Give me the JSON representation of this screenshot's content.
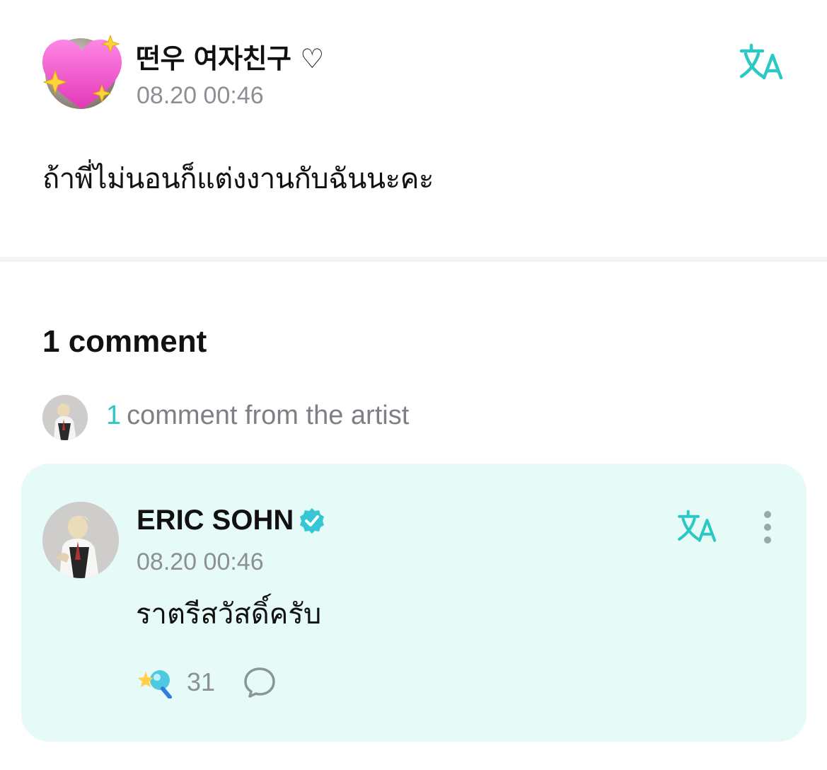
{
  "post": {
    "author": "떤우 여자친구 ♡",
    "timestamp": "08.20 00:46",
    "body": "ถ้าพี่ไม่นอนก็แต่งงานกับฉันนะคะ",
    "avatar_icon": "sparkling-heart-icon",
    "translate_icon": "translate-icon"
  },
  "comments": {
    "heading": "1 comment",
    "artist_summary": {
      "count": "1",
      "text": "comment from the artist"
    },
    "items": [
      {
        "author": "ERIC SOHN",
        "verified": true,
        "timestamp": "08.20 00:46",
        "text": "ราตรีสวัสดิ์ครับ",
        "reaction_count": "31",
        "reaction_icon": "star-lightstick-icon",
        "reply_icon": "speech-bubble-icon",
        "more_icon": "more-vertical-icon"
      }
    ]
  },
  "colors": {
    "accent": "#2bc8c4",
    "card_background": "#e6faf7",
    "muted_text": "#8c8f94",
    "verified_badge": "#35c6d8"
  }
}
